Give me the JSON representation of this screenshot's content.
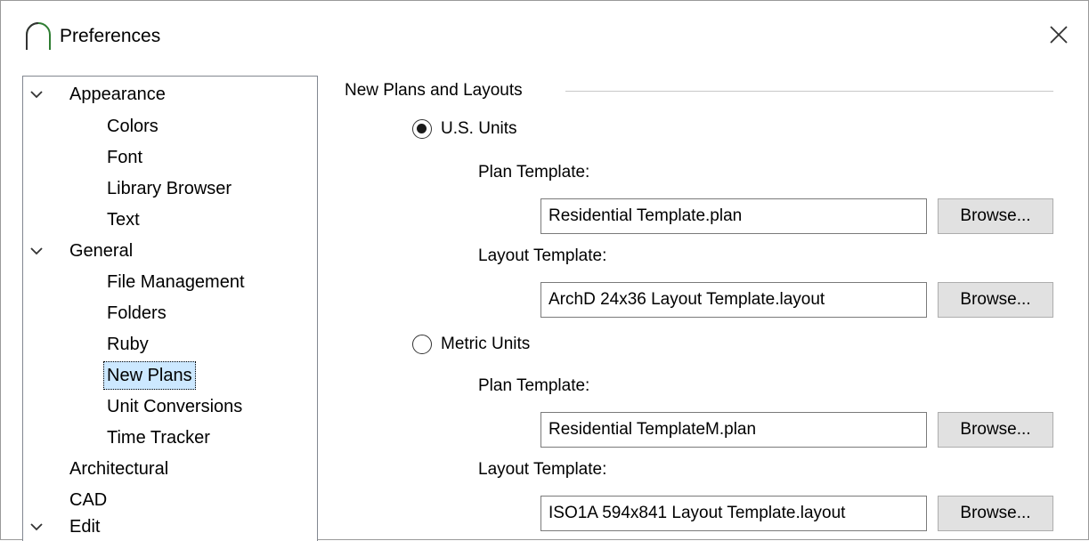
{
  "window": {
    "title": "Preferences"
  },
  "tree": {
    "items": [
      {
        "label": "Appearance",
        "expandable": true
      },
      {
        "label": "Colors"
      },
      {
        "label": "Font"
      },
      {
        "label": "Library Browser"
      },
      {
        "label": "Text"
      },
      {
        "label": "General",
        "expandable": true
      },
      {
        "label": "File Management"
      },
      {
        "label": "Folders"
      },
      {
        "label": "Ruby"
      },
      {
        "label": "New Plans",
        "selected": true
      },
      {
        "label": "Unit Conversions"
      },
      {
        "label": "Time Tracker"
      },
      {
        "label": "Architectural"
      },
      {
        "label": "CAD"
      },
      {
        "label": "Edit",
        "expandable": true
      }
    ],
    "selected_color": "#cce8ff"
  },
  "panel": {
    "group_title": "New Plans and Layouts",
    "us_units": {
      "label": "U.S. Units",
      "checked": true,
      "plan_label": "Plan Template:",
      "plan_value": "Residential Template.plan",
      "layout_label": "Layout Template:",
      "layout_value": "ArchD 24x36 Layout Template.layout"
    },
    "metric_units": {
      "label": "Metric Units",
      "checked": false,
      "plan_label": "Plan Template:",
      "plan_value": "Residential TemplateM.plan",
      "layout_label": "Layout Template:",
      "layout_value": "ISO1A 594x841 Layout Template.layout"
    },
    "browse_label": "Browse..."
  },
  "icons": {
    "app": "arch-logo-icon",
    "close": "close-icon",
    "expand": "chevron-down-icon"
  }
}
